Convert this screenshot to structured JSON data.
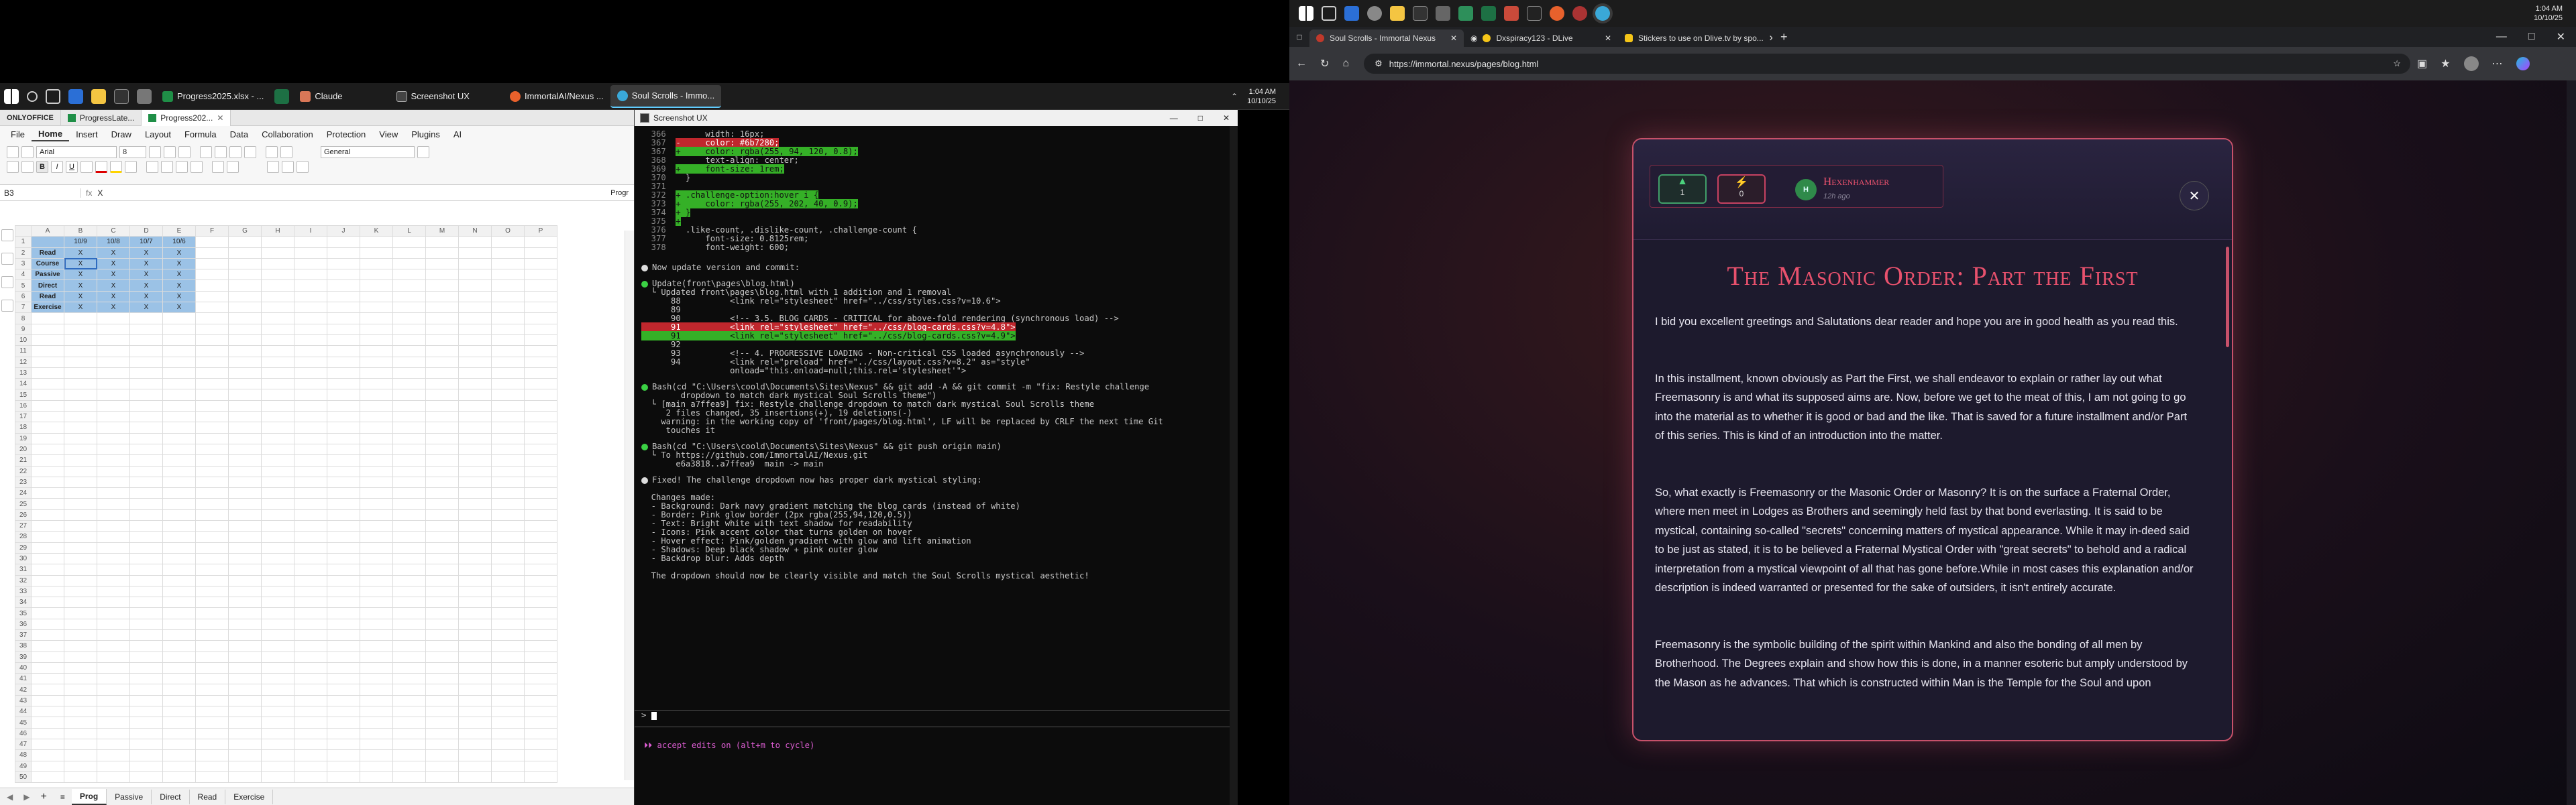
{
  "left_taskbar": {
    "apps": [
      "Progress2025.xlsx - ...",
      "Claude",
      "Screenshot UX",
      "ImmortalAI/Nexus ...",
      "Soul Scrolls - Immo..."
    ],
    "time": "1:04 AM",
    "date": "10/10/25"
  },
  "onlyoffice": {
    "brand": "ONLYOFFICE",
    "tabs": [
      "ProgressLate...",
      "Progress202..."
    ],
    "menu": [
      "File",
      "Home",
      "Insert",
      "Draw",
      "Layout",
      "Formula",
      "Data",
      "Collaboration",
      "Protection",
      "View",
      "Plugins",
      "AI"
    ],
    "active_menu": "Home",
    "font": "Arial",
    "font_size": "8",
    "number_format": "General",
    "cell_ref": "B3",
    "formula": "X",
    "col_headers": [
      "A",
      "B",
      "C",
      "D",
      "E",
      "F",
      "G",
      "H",
      "I",
      "J",
      "K",
      "L",
      "M",
      "N",
      "O",
      "P"
    ],
    "date_headers": [
      "10/9",
      "10/8",
      "10/7",
      "10/6"
    ],
    "rows": [
      {
        "label": "Read",
        "marks": [
          "X",
          "X",
          "X",
          "X"
        ]
      },
      {
        "label": "Course",
        "marks": [
          "X",
          "X",
          "X",
          "X"
        ]
      },
      {
        "label": "Passive",
        "marks": [
          "X",
          "X",
          "X",
          "X"
        ]
      },
      {
        "label": "Direct",
        "marks": [
          "X",
          "X",
          "X",
          "X"
        ]
      },
      {
        "label": "Read",
        "marks": [
          "X",
          "X",
          "X",
          "X"
        ]
      },
      {
        "label": "Exercise",
        "marks": [
          "X",
          "X",
          "X",
          "X"
        ]
      }
    ],
    "sheet_tabs": [
      "Prog",
      "Passive",
      "Direct",
      "Read",
      "Exercise"
    ],
    "progress_label": "Progr"
  },
  "terminal": {
    "title": "Screenshot UX",
    "lines": [
      {
        "n": "366",
        "t": "      width: 16px;",
        "c": ""
      },
      {
        "n": "367",
        "t": "-     color: #6b7280;",
        "c": "del"
      },
      {
        "n": "367",
        "t": "+     color: rgba(255, 94, 120, 0.8);",
        "c": "add"
      },
      {
        "n": "368",
        "t": "      text-align: center;",
        "c": ""
      },
      {
        "n": "369",
        "t": "+     font-size: 1rem;",
        "c": "add"
      },
      {
        "n": "370",
        "t": "  }",
        "c": ""
      },
      {
        "n": "371",
        "t": "",
        "c": ""
      },
      {
        "n": "372",
        "t": "+ .challenge-option:hover i {",
        "c": "add"
      },
      {
        "n": "373",
        "t": "+     color: rgba(255, 202, 40, 0.9);",
        "c": "add"
      },
      {
        "n": "374",
        "t": "+ }",
        "c": "add"
      },
      {
        "n": "375",
        "t": "+",
        "c": "add"
      },
      {
        "n": "376",
        "t": "  .like-count, .dislike-count, .challenge-count {",
        "c": ""
      },
      {
        "n": "377",
        "t": "      font-size: 0.8125rem;",
        "c": ""
      },
      {
        "n": "378",
        "t": "      font-weight: 600;",
        "c": ""
      }
    ],
    "blocks": [
      {
        "b": "w",
        "lines": [
          "Now update version and commit:"
        ]
      },
      {
        "b": "g",
        "lines": [
          "Update(front\\pages\\blog.html)",
          "└ Updated front\\pages\\blog.html with 1 addition and 1 removal",
          "    88          <link rel=\"stylesheet\" href=\"../css/styles.css?v=10.6\">",
          "    89",
          "    90          <!-- 3.5. BLOG CARDS - CRITICAL for above-fold rendering (synchronous load) -->",
          "D91          <link rel=\"stylesheet\" href=\"../css/blog-cards.css?v=4.8\">",
          "A91          <link rel=\"stylesheet\" href=\"../css/blog-cards.css?v=4.9\">",
          "    92",
          "    93          <!-- 4. PROGRESSIVE LOADING - Non-critical CSS loaded asynchronously -->",
          "    94          <link rel=\"preload\" href=\"../css/layout.css?v=8.2\" as=\"style\"",
          "                onload=\"this.onload=null;this.rel='stylesheet'\">"
        ]
      },
      {
        "b": "g",
        "lines": [
          "Bash(cd \"C:\\Users\\coold\\Documents\\Sites\\Nexus\" && git add -A && git commit -m \"fix: Restyle challenge",
          "      dropdown to match dark mystical Soul Scrolls theme\")",
          "└ [main a7ffea9] fix: Restyle challenge dropdown to match dark mystical Soul Scrolls theme",
          "   2 files changed, 35 insertions(+), 19 deletions(-)",
          "  warning: in the working copy of 'front/pages/blog.html', LF will be replaced by CRLF the next time Git",
          "   touches it"
        ]
      },
      {
        "b": "g",
        "lines": [
          "Bash(cd \"C:\\Users\\coold\\Documents\\Sites\\Nexus\" && git push origin main)",
          "└ To https://github.com/ImmortalAI/Nexus.git",
          "     e6a3818..a7ffea9  main -> main"
        ]
      },
      {
        "b": "w",
        "lines": [
          "Fixed! The challenge dropdown now has proper dark mystical styling:",
          "",
          "Changes made:",
          "- Background: Dark navy gradient matching the blog cards (instead of white)",
          "- Border: Pink glow border (2px rgba(255,94,120,0.5))",
          "- Text: Bright white with text shadow for readability",
          "- Icons: Pink accent color that turns golden on hover",
          "- Hover effect: Pink/golden gradient with glow and lift animation",
          "- Shadows: Deep black shadow + pink outer glow",
          "- Backdrop blur: Adds depth",
          "",
          "The dropdown should now be clearly visible and match the Soul Scrolls mystical aesthetic!"
        ]
      }
    ],
    "prompt": ">",
    "mode": "⏵⏵ accept edits on (alt+m to cycle)"
  },
  "right_taskbar": {
    "time": "1:04 AM",
    "date": "10/10/25"
  },
  "browser": {
    "tabs": [
      "Soul Scrolls - Immortal Nexus",
      "Dxspiracy123 - DLive",
      "Stickers to use on Dlive.tv by spo..."
    ],
    "url": "https://immortal.nexus/pages/blog.html"
  },
  "post": {
    "likes": "1",
    "dislikes": "0",
    "author": "Hexenhammer",
    "avatar_initial": "H",
    "time_ago": "12h ago",
    "title": "The Masonic Order: Part the First",
    "paragraphs": [
      "I bid you excellent greetings and Salutations dear reader and hope you are in good health as you read this.",
      "In this installment, known obviously as Part the First, we shall endeavor to explain or rather lay out what Freemasonry is and what its supposed aims are. Now, before we get to the meat of this, I am not going to go into the material as to whether it is good or bad and the like. That is saved for a future installment and/or Part of this series. This is kind of an introduction into the matter.",
      "So, what exactly is Freemasonry or the Masonic Order or Masonry? It is on the surface a Fraternal Order, where men meet in Lodges as Brothers and seemingly held fast by that bond everlasting. It is said to be mystical, containing so-called \"secrets\" concerning matters of mystical appearance. While it may in-deed said to be just as stated, it is to be believed a Fraternal Mystical Order with \"great secrets\" to behold and a radical interpretation from a mystical viewpoint of all that has gone before.While in most cases this explanation and/or description is indeed warranted or presented for the sake of outsiders, it isn't entirely accurate.",
      "Freemasonry is the symbolic building of the spirit within Mankind and also the bonding of all men by Brotherhood. The Degrees explain and show how this is done, in a manner esoteric but amply understood by the Mason as he advances. That which is constructed within Man is the Temple for the Soul and upon"
    ]
  }
}
